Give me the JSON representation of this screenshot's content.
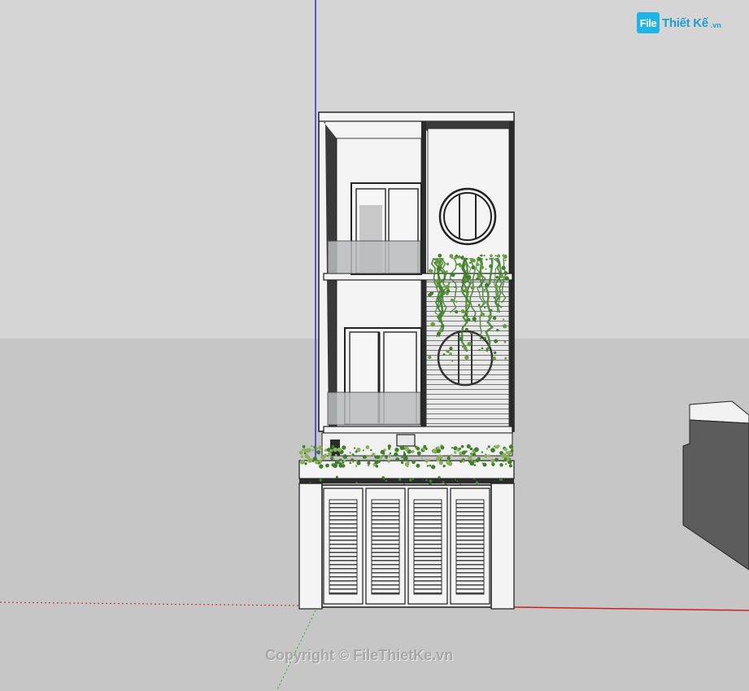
{
  "viewport": {
    "sky_color": "#d5d5d5",
    "ground_color": "#c6c6c6",
    "blue_axis_color": "#2b2bd6",
    "red_axis_color": "#cc2222",
    "green_axis_color": "#33aa33"
  },
  "model": {
    "wall_color": "#f4f4f4",
    "outline_color": "#1a1a1a",
    "glass_color": "#b9bcbd",
    "plant_color": "#3f7f2c",
    "neighbor_color": "#5c5c5c"
  },
  "branding": {
    "logo_mark": "File",
    "logo_word": "Thiết Kế",
    "logo_tld": ".vn",
    "watermark": "Copyright © FileThietKe.vn"
  }
}
